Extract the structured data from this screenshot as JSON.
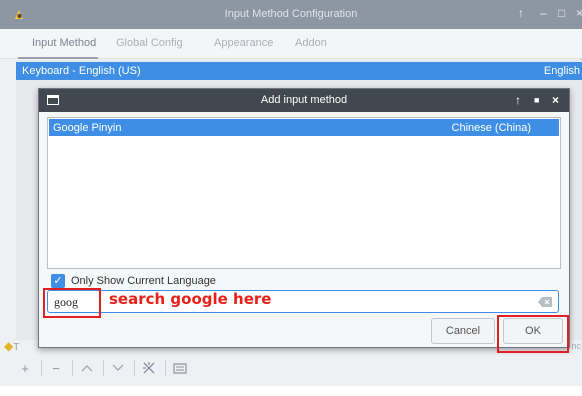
{
  "outer": {
    "title": "Input Method Configuration",
    "tabs": [
      "Input Method",
      "Global Config",
      "Appearance",
      "Addon"
    ],
    "selected_row": {
      "name": "Keyboard - English (US)",
      "lang": "English"
    },
    "left_edge_text": "T",
    "right_edge_text": "nc",
    "controls": {
      "up": "↑",
      "min": "–",
      "max": "□",
      "close": "×"
    }
  },
  "dialog": {
    "title": "Add input method",
    "controls": {
      "up": "↑",
      "max": "■",
      "close": "×"
    },
    "results": [
      {
        "name": "Google Pinyin",
        "lang": "Chinese (China)"
      }
    ],
    "checkbox_label": "Only Show Current Language",
    "checkbox_checked": true,
    "search_value": "goog",
    "annotation_text": "search google here",
    "cancel_label": "Cancel",
    "ok_label": "OK"
  },
  "colors": {
    "selection": "#3d8ee4",
    "annotation": "#e02020",
    "titlebar_dark": "#414850",
    "titlebar_outer": "#8d97a4"
  }
}
